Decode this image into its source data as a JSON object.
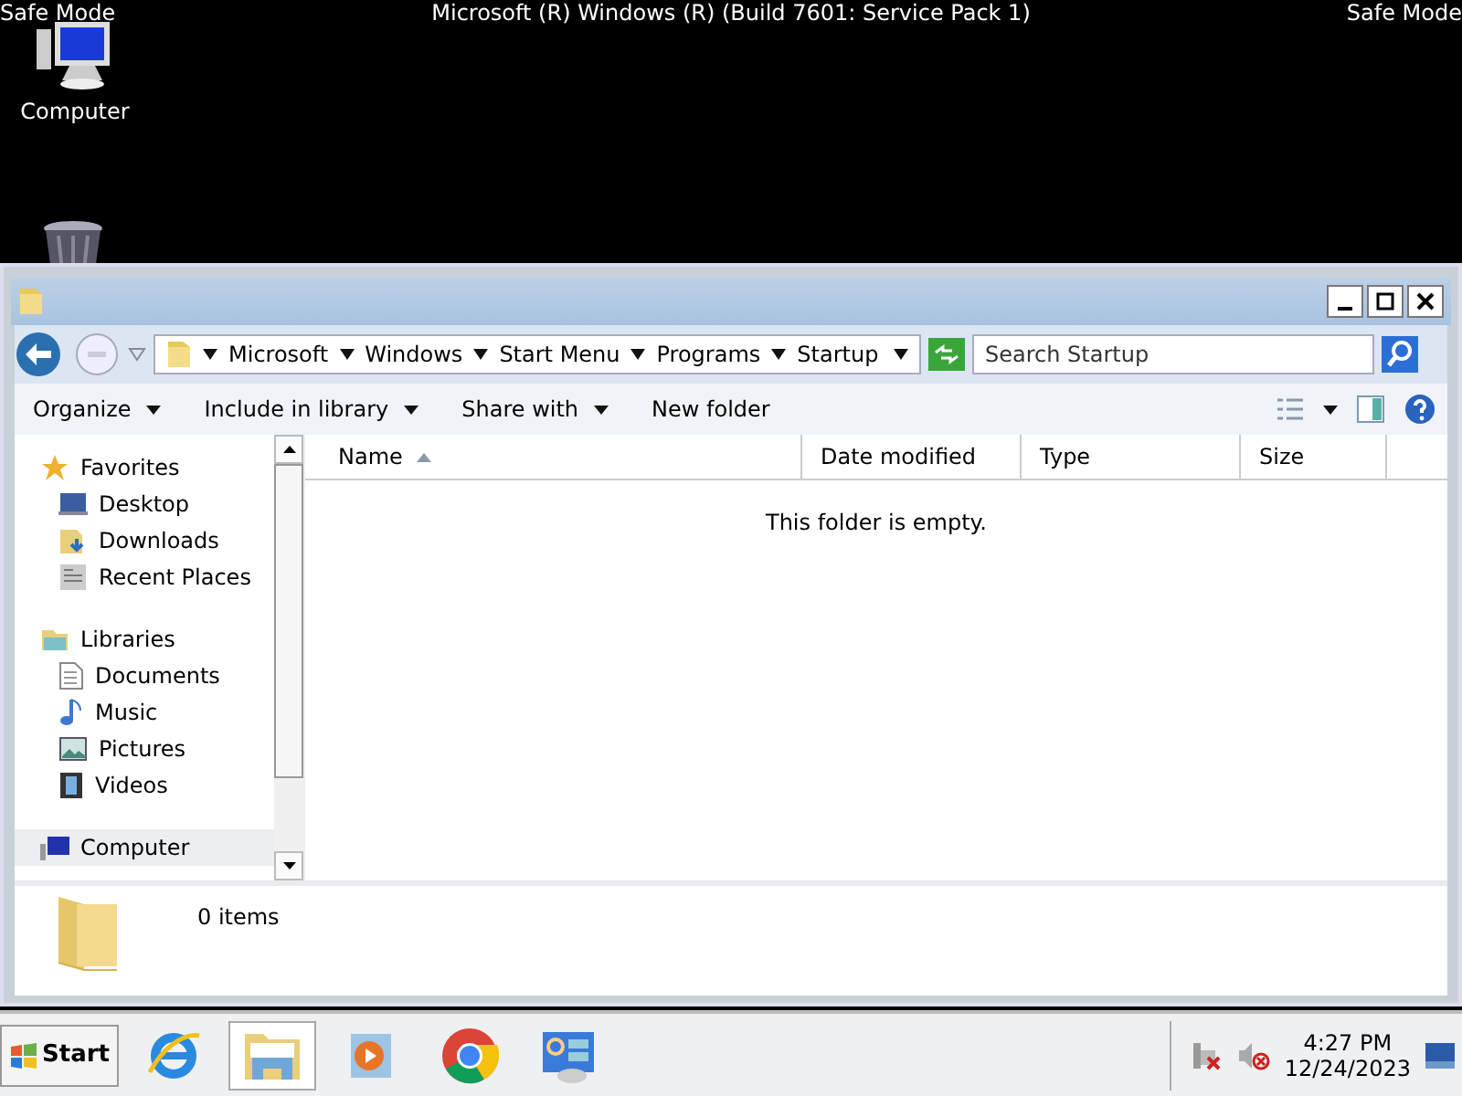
{
  "desktop": {
    "mode_left": "Safe Mode",
    "build": "Microsoft (R) Windows (R) (Build 7601: Service Pack 1)",
    "mode_right": "Safe Mode",
    "icons": [
      {
        "label": "Computer"
      }
    ]
  },
  "window": {
    "address": [
      "Microsoft",
      "Windows",
      "Start Menu",
      "Programs",
      "Startup"
    ],
    "search": {
      "placeholder": "Search Startup"
    },
    "toolbar": [
      {
        "label": "Organize",
        "dropdown": true
      },
      {
        "label": "Include in library",
        "dropdown": true
      },
      {
        "label": "Share with",
        "dropdown": true
      },
      {
        "label": "New folder",
        "dropdown": false
      }
    ],
    "sidebar": [
      {
        "label": "Favorites",
        "selected": false,
        "items": [
          {
            "label": "Desktop",
            "selected": false
          },
          {
            "label": "Downloads",
            "selected": false
          },
          {
            "label": "Recent Places",
            "selected": false
          }
        ]
      },
      {
        "label": "Libraries",
        "selected": false,
        "items": [
          {
            "label": "Documents",
            "selected": false
          },
          {
            "label": "Music",
            "selected": false
          },
          {
            "label": "Pictures",
            "selected": false
          },
          {
            "label": "Videos",
            "selected": false
          }
        ]
      },
      {
        "label": "Computer",
        "selected": true
      }
    ],
    "columns": [
      {
        "label": "Name",
        "sorted": true
      },
      {
        "label": "Date modified",
        "sorted": false
      },
      {
        "label": "Type",
        "sorted": false
      },
      {
        "label": "Size",
        "sorted": false
      }
    ],
    "empty_message": "This folder is empty.",
    "status": "0 items"
  },
  "taskbar": {
    "start": "Start",
    "items": [
      {
        "selected": false
      },
      {
        "selected": true
      },
      {
        "selected": false
      },
      {
        "selected": false
      },
      {
        "selected": false
      }
    ],
    "time": "4:27 PM",
    "date": "12/24/2023"
  }
}
